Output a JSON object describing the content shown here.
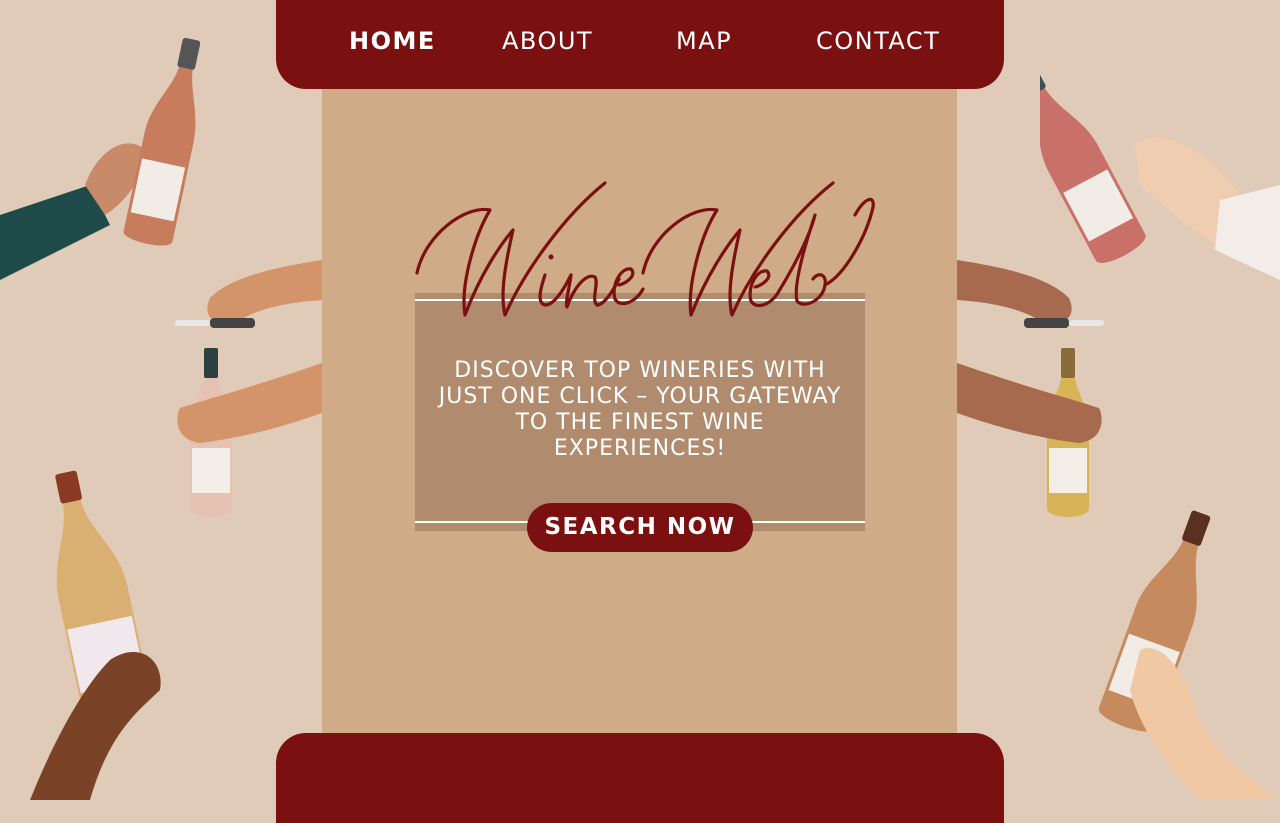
{
  "nav": {
    "items": [
      {
        "label": "HOME",
        "active": true
      },
      {
        "label": "ABOUT",
        "active": false
      },
      {
        "label": "MAP",
        "active": false
      },
      {
        "label": "CONTACT",
        "active": false
      }
    ]
  },
  "hero": {
    "logo_text": "Wine Web",
    "tagline": "DISCOVER TOP WINERIES WITH JUST ONE CLICK – YOUR GATEWAY TO THE FINEST WINE EXPERIENCES!",
    "cta_label": "SEARCH NOW"
  },
  "colors": {
    "brand": "#7b1010",
    "page_bg": "#e0cbb9",
    "panel_bg": "#cfac87",
    "hero_box": "#b18b6e",
    "text_light": "#ffffff"
  },
  "decorations": [
    "hand-holding-rose-bottle-icon",
    "hand-opening-rose-bottle-corkscrew-icon",
    "hand-holding-white-wine-bottle-icon",
    "hand-holding-red-rose-bottle-icon",
    "hand-opening-white-bottle-corkscrew-icon",
    "hand-holding-orange-wine-bottle-icon"
  ]
}
